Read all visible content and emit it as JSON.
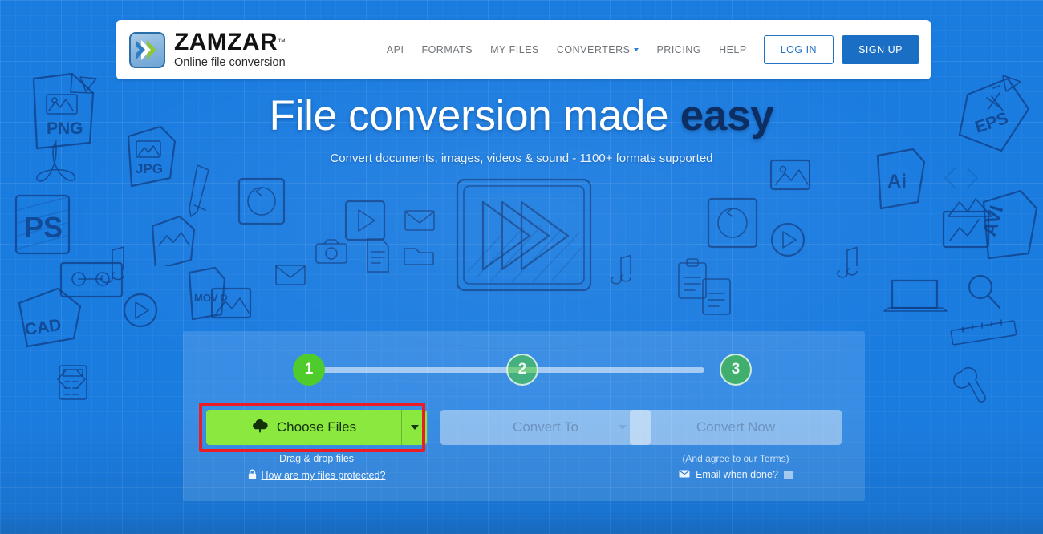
{
  "header": {
    "brand": "ZAMZAR",
    "trademark": "™",
    "tagline": "Online file conversion",
    "logo_icon": "double-chevron-logo-icon",
    "nav": [
      {
        "label": "API",
        "has_caret": false
      },
      {
        "label": "FORMATS",
        "has_caret": false
      },
      {
        "label": "MY FILES",
        "has_caret": false
      },
      {
        "label": "CONVERTERS",
        "has_caret": true
      },
      {
        "label": "PRICING",
        "has_caret": false
      },
      {
        "label": "HELP",
        "has_caret": false
      }
    ],
    "login_label": "LOG IN",
    "signup_label": "SIGN UP"
  },
  "hero": {
    "title_plain": "File conversion made ",
    "title_accent": "easy",
    "subtitle": "Convert documents, images, videos & sound - 1100+ formats supported"
  },
  "converter": {
    "steps": [
      {
        "number": "1",
        "state": "active"
      },
      {
        "number": "2",
        "state": "inactive"
      },
      {
        "number": "3",
        "state": "inactive"
      }
    ],
    "choose_files_label": "Choose Files",
    "choose_files_icon": "cloud-upload-icon",
    "choose_files_caret_icon": "chevron-down-icon",
    "convert_to_label": "Convert To",
    "convert_to_caret_icon": "chevron-down-icon",
    "convert_now_label": "Convert Now",
    "drag_drop_label": "Drag & drop files",
    "protected_icon": "lock-icon",
    "protected_link": "How are my files protected?",
    "terms_text_prefix": "(And agree to our ",
    "terms_link": "Terms",
    "terms_text_suffix": ")",
    "email_icon": "envelope-icon",
    "email_label": "Email when done?",
    "email_checked": false
  },
  "annotation": {
    "target": "choose-files-button",
    "color": "#ED1C24"
  },
  "colors": {
    "page_background": "#1B7CE0",
    "header_background": "#FFFFFF",
    "signup_button": "#1A6FC4",
    "login_text": "#2272C4",
    "choose_files_button": "#8AE83F",
    "step_active": "#4DCC2B",
    "hero_accent": "#0D2E63",
    "disabled_button": "rgba(255,255,255,0.42)",
    "panel_overlay": "rgba(255,255,255,0.13)"
  },
  "background_doodles": [
    "png-file-icon",
    "jpg-file-icon",
    "eps-file-icon",
    "ai-file-icon",
    "ps-file-icon",
    "cad-file-icon",
    "avi-file-icon",
    "mov-file-icon",
    "play-button-icon",
    "music-note-icon",
    "envelope-icon",
    "camera-icon",
    "folder-icon",
    "clipboard-icon",
    "laptop-icon",
    "magnifier-icon",
    "ruler-icon",
    "pencil-icon",
    "wrench-icon",
    "cassette-icon",
    "image-icon",
    "refresh-icon",
    "code-icon",
    "calculator-icon"
  ]
}
